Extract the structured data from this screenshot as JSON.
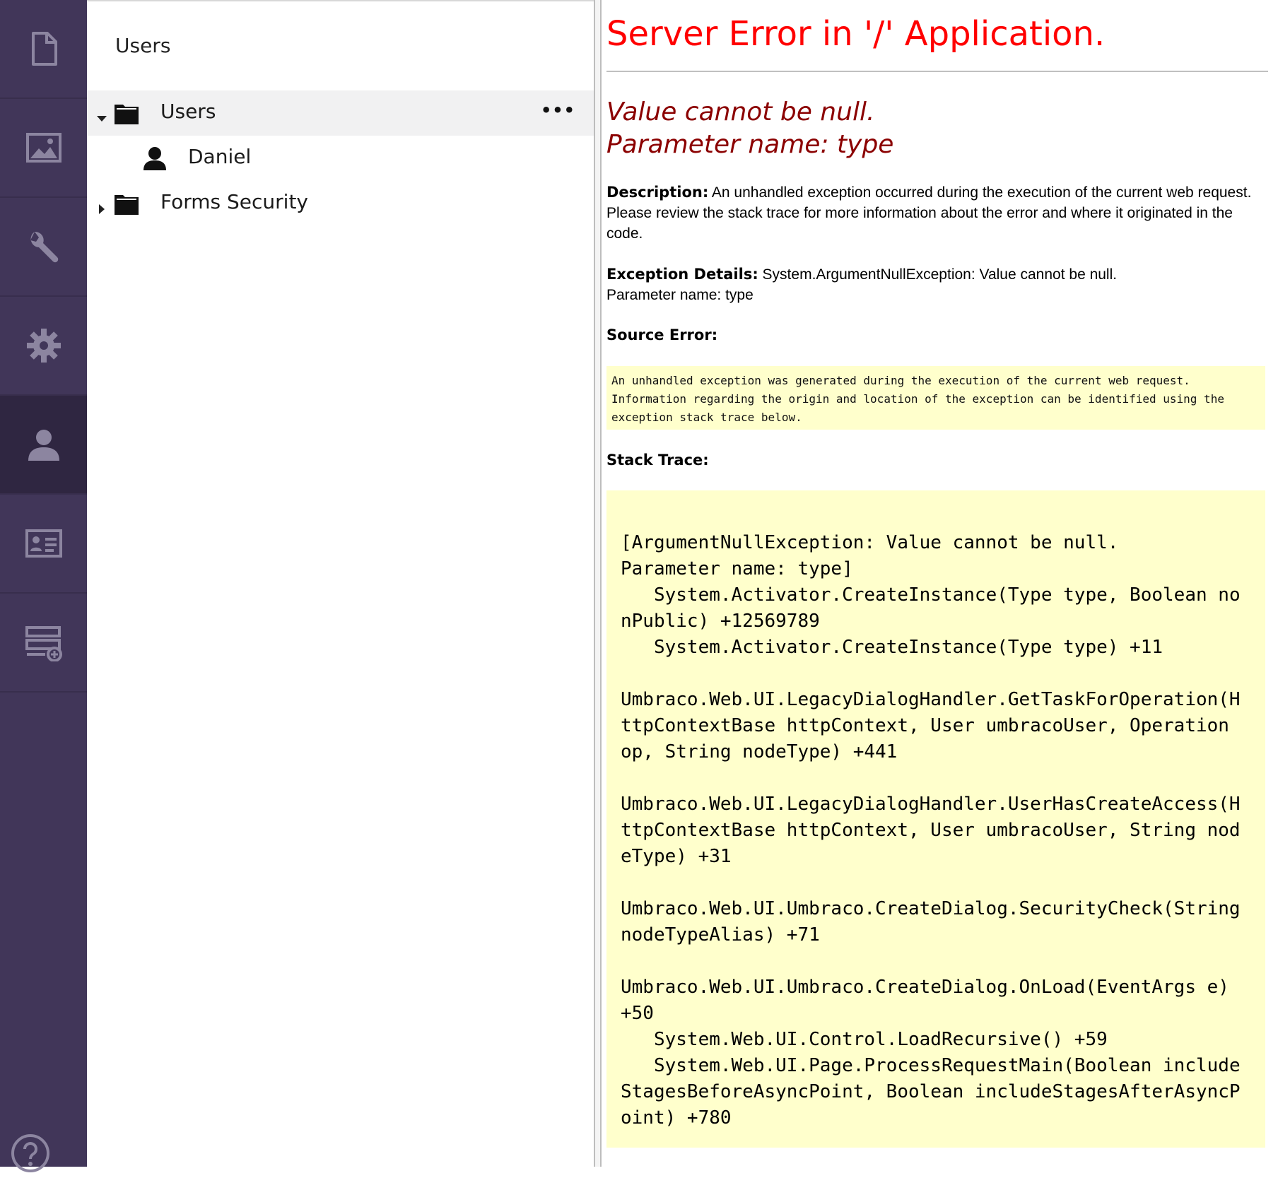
{
  "rail": {
    "items": [
      {
        "name": "content",
        "icon": "document-icon"
      },
      {
        "name": "media",
        "icon": "image-icon"
      },
      {
        "name": "developer",
        "icon": "wrench-icon"
      },
      {
        "name": "settings",
        "icon": "gear-icon"
      },
      {
        "name": "users",
        "icon": "user-icon",
        "active": true
      },
      {
        "name": "members",
        "icon": "id-card-icon"
      },
      {
        "name": "forms",
        "icon": "form-add-icon"
      }
    ],
    "help_icon": "help-icon",
    "colors": {
      "background": "#413659",
      "active": "#2f2641",
      "icon": "#8c85a0"
    }
  },
  "tree": {
    "title": "Users",
    "items": [
      {
        "label": "Users",
        "icon": "folder-icon",
        "expanded": true,
        "selected": true,
        "actions": "•••"
      },
      {
        "label": "Daniel",
        "icon": "user-icon"
      },
      {
        "label": "Forms Security",
        "icon": "folder-icon",
        "expanded": false
      }
    ]
  },
  "error": {
    "title": "Server Error in '/' Application.",
    "message_line1": "Value cannot be null.",
    "message_line2": "Parameter name: type",
    "description_label": "Description:",
    "description_text": " An unhandled exception occurred during the execution of the current web request. Please review the stack trace for more information about the error and where it originated in the code.",
    "exception_label": "Exception Details:",
    "exception_text": " System.ArgumentNullException: Value cannot be null.",
    "exception_text2": "Parameter name: type",
    "source_error_label": "Source Error:",
    "source_error_text": "An unhandled exception was generated during the execution of the current web request.\nInformation regarding the origin and location of the exception can be identified using the\nexception stack trace below.",
    "stack_trace_label": "Stack Trace:",
    "stack_trace": "[ArgumentNullException: Value cannot be null.\nParameter name: type]\n   System.Activator.CreateInstance(Type type, Boolean nonPublic) +12569789\n   System.Activator.CreateInstance(Type type) +11\n\nUmbraco.Web.UI.LegacyDialogHandler.GetTaskForOperation(HttpContextBase httpContext, User umbracoUser, Operation op, String nodeType) +441\n\nUmbraco.Web.UI.LegacyDialogHandler.UserHasCreateAccess(HttpContextBase httpContext, User umbracoUser, String nodeType) +31\n\nUmbraco.Web.UI.Umbraco.CreateDialog.SecurityCheck(String nodeTypeAlias) +71\n\nUmbraco.Web.UI.Umbraco.CreateDialog.OnLoad(EventArgs e) +50\n   System.Web.UI.Control.LoadRecursive() +59\n   System.Web.UI.Page.ProcessRequestMain(Boolean includeStagesBeforeAsyncPoint, Boolean includeStagesAfterAsyncPoint) +780",
    "colors": {
      "title": "#ff0000",
      "message": "#8b0000",
      "code_background": "#ffffcc"
    }
  }
}
